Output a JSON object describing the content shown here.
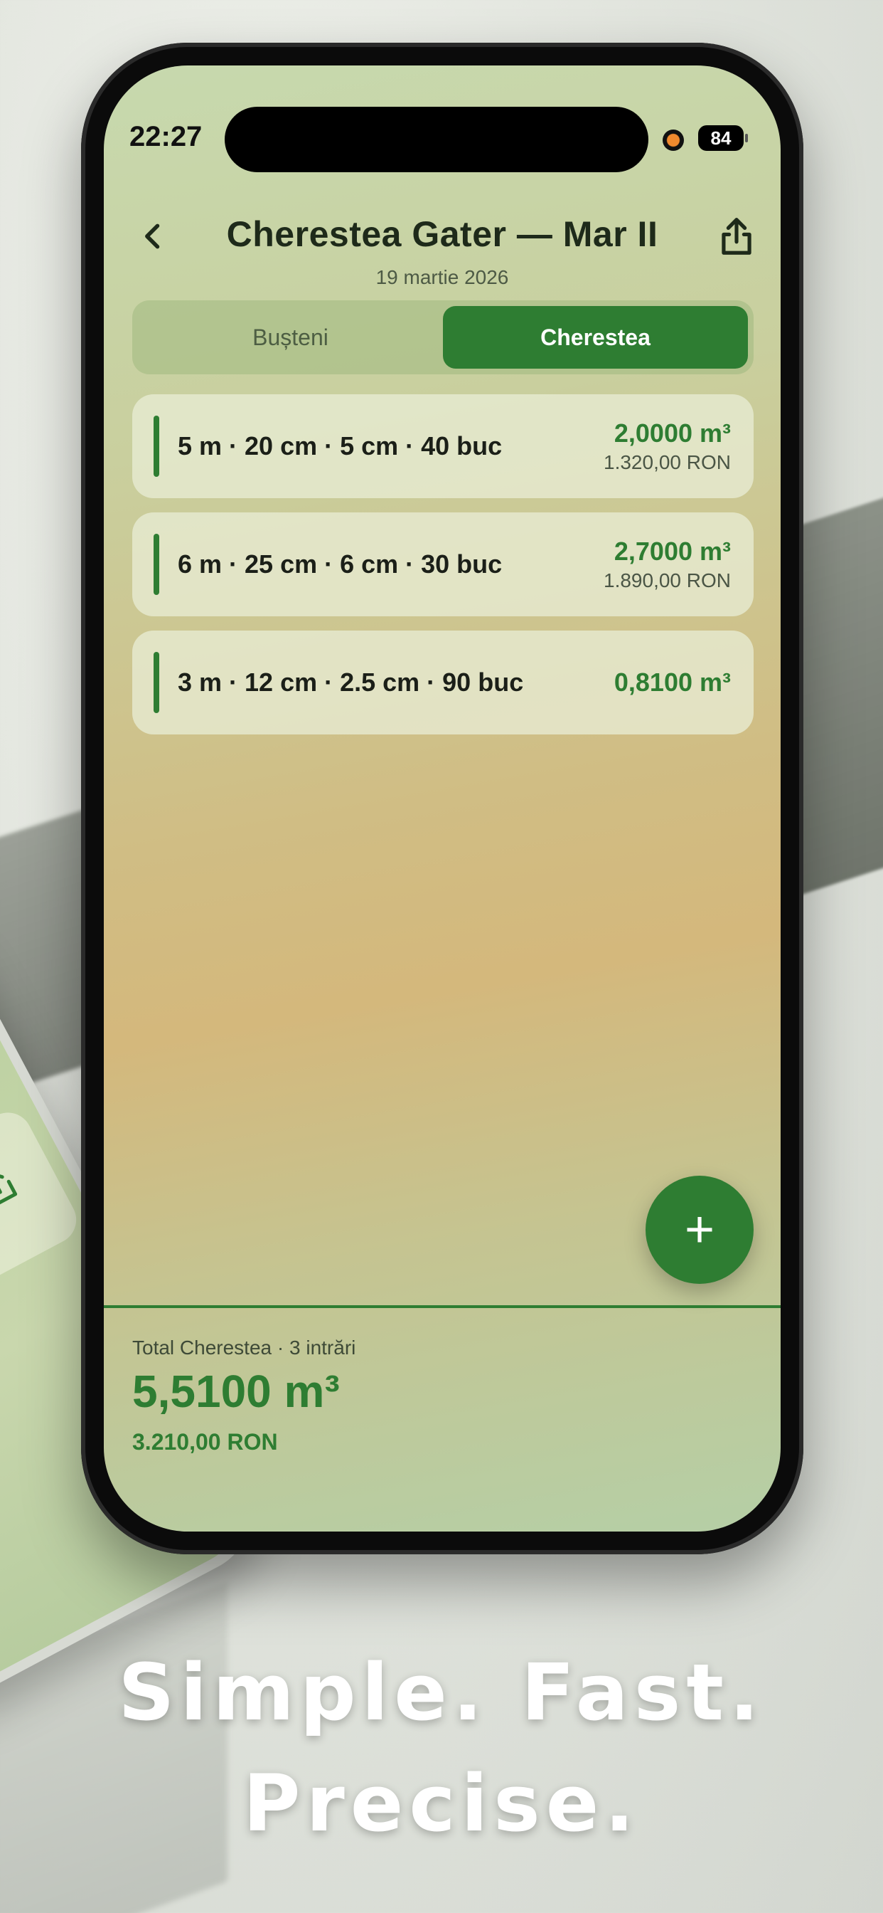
{
  "status_bar": {
    "time": "22:27",
    "battery": "84"
  },
  "header": {
    "title": "Cherestea Gater — Mar II",
    "date": "19 martie 2026"
  },
  "tabs": [
    {
      "label": "Bușteni",
      "active": false
    },
    {
      "label": "Cherestea",
      "active": true
    }
  ],
  "entries": [
    {
      "label": "5 m · 20 cm · 5 cm · 40 buc",
      "volume": "2,0000 m³",
      "price": "1.320,00 RON"
    },
    {
      "label": "6 m · 25 cm · 6 cm · 30 buc",
      "volume": "2,7000 m³",
      "price": "1.890,00 RON"
    },
    {
      "label": "3 m · 12 cm · 2.5 cm · 90 buc",
      "volume": "0,8100 m³",
      "price": ""
    }
  ],
  "add_button": {
    "icon": "plus-icon",
    "label": "+"
  },
  "summary": {
    "caption": "Total Cherestea · 3 intrări",
    "total_volume": "5,5100 m³",
    "total_price": "3.210,00 RON"
  },
  "tagline": {
    "line1": "Simple. Fast.",
    "line2": "Precise."
  },
  "colors": {
    "accent": "#2e7d32",
    "accent_text": "#ffffff"
  }
}
